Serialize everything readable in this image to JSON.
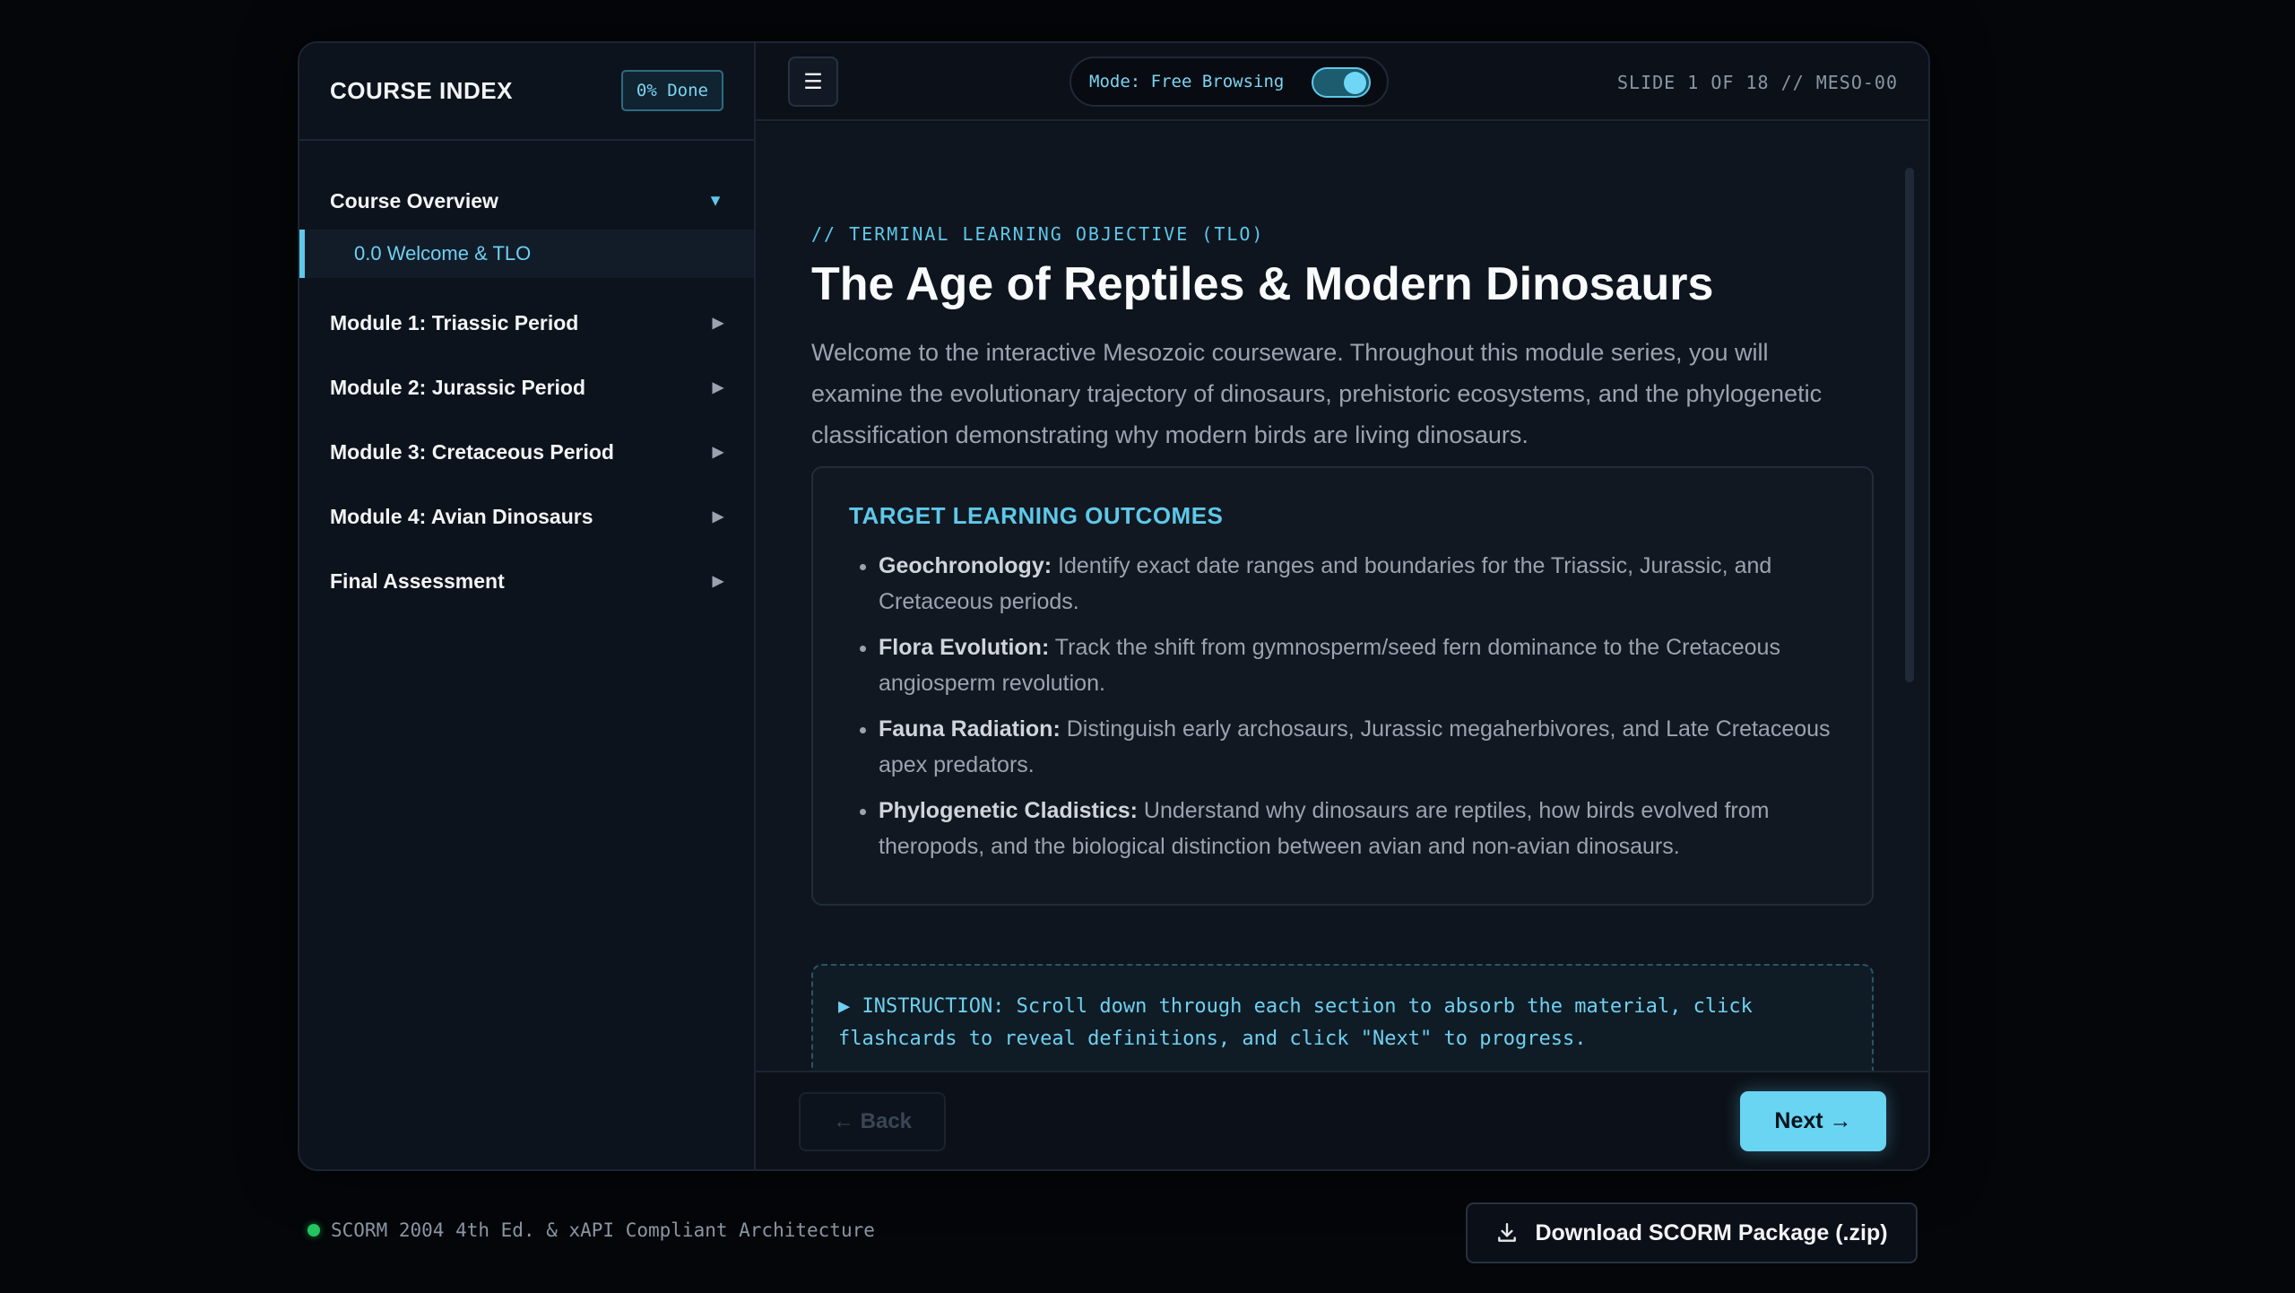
{
  "sidebar": {
    "title": "COURSE INDEX",
    "progress": "0% Done",
    "sections": [
      {
        "label": "Course Overview",
        "arrow": "▼"
      },
      {
        "label": "Module 1: Triassic Period",
        "arrow": "▶"
      },
      {
        "label": "Module 2: Jurassic Period",
        "arrow": "▶"
      },
      {
        "label": "Module 3: Cretaceous Period",
        "arrow": "▶"
      },
      {
        "label": "Module 4: Avian Dinosaurs",
        "arrow": "▶"
      },
      {
        "label": "Final Assessment",
        "arrow": "▶"
      }
    ],
    "active_sub": "0.0 Welcome & TLO"
  },
  "topbar": {
    "menu_icon": "☰",
    "mode_label": "Mode: Free Browsing",
    "slide_counter": "SLIDE 1 OF 18 // MESO-00"
  },
  "content": {
    "kicker": "// TERMINAL LEARNING OBJECTIVE (TLO)",
    "title": "The Age of Reptiles & Modern Dinosaurs",
    "intro": "Welcome to the interactive Mesozoic courseware. Throughout this module series, you will examine the evolutionary trajectory of dinosaurs, prehistoric ecosystems, and the phylogenetic classification demonstrating why modern birds are living dinosaurs.",
    "outcomes_heading": "TARGET LEARNING OUTCOMES",
    "outcomes": [
      {
        "term": "Geochronology:",
        "text": " Identify exact date ranges and boundaries for the Triassic, Jurassic, and Cretaceous periods."
      },
      {
        "term": "Flora Evolution:",
        "text": " Track the shift from gymnosperm/seed fern dominance to the Cretaceous angiosperm revolution."
      },
      {
        "term": "Fauna Radiation:",
        "text": " Distinguish early archosaurs, Jurassic megaherbivores, and Late Cretaceous apex predators."
      },
      {
        "term": "Phylogenetic Cladistics:",
        "text": " Understand why dinosaurs are reptiles, how birds evolved from theropods, and the biological distinction between avian and non-avian dinosaurs."
      }
    ],
    "instruction": "▶ INSTRUCTION: Scroll down through each section to absorb the material, click flashcards to reveal definitions, and click \"Next\" to progress."
  },
  "nav_buttons": {
    "back": "← Back",
    "next": "Next →"
  },
  "footer": {
    "status": "SCORM 2004 4th Ed. & xAPI Compliant Architecture",
    "download": "Download SCORM Package (.zip)"
  },
  "colors": {
    "accent": "#5ec8ea",
    "status_ok": "#22c55e"
  }
}
